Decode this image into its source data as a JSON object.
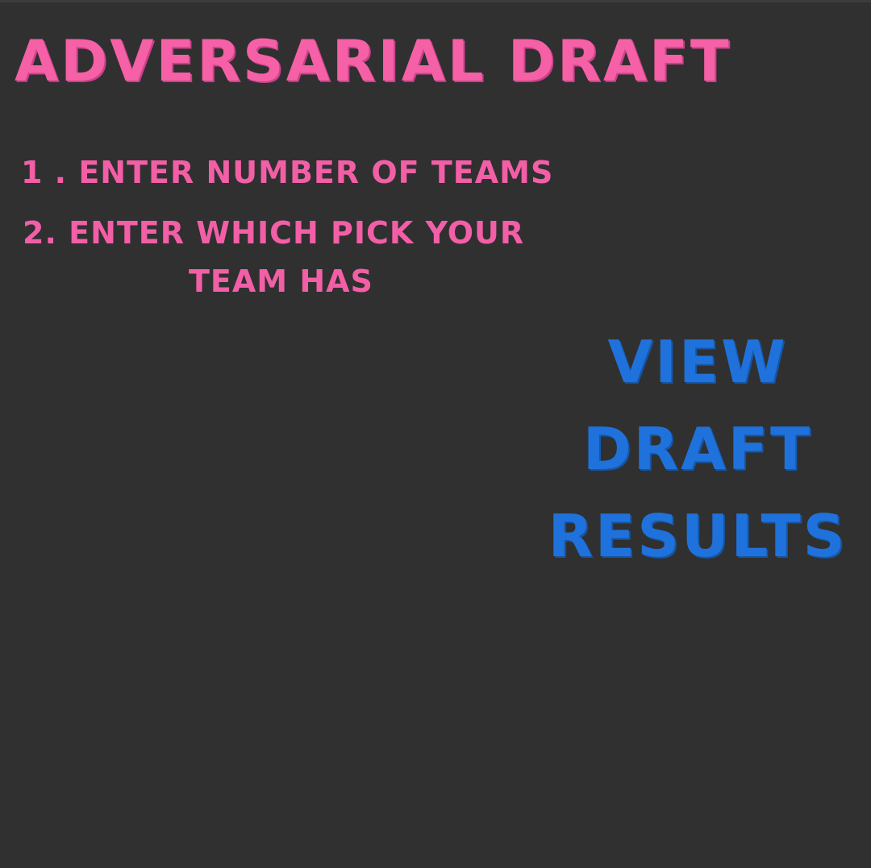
{
  "app": {
    "title": "ADVERSARIAL DRAFT"
  },
  "instructions": {
    "step1": "1 . ENTER NUMBER OF TEAMS",
    "step2_line1": "2. ENTER WHICH PICK YOUR",
    "step2_line2": "TEAM HAS"
  },
  "results_button": {
    "line1": "VIEW",
    "line2": "DRAFT",
    "line3": "RESULTS"
  },
  "colors": {
    "background": "#303030",
    "accent_pink": "#f560a6",
    "accent_blue": "#1f72db"
  }
}
